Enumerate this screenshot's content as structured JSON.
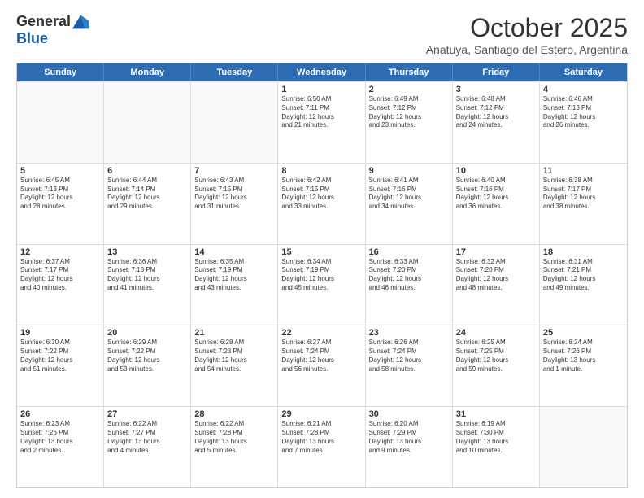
{
  "logo": {
    "general": "General",
    "blue": "Blue"
  },
  "title": "October 2025",
  "subtitle": "Anatuya, Santiago del Estero, Argentina",
  "days_of_week": [
    "Sunday",
    "Monday",
    "Tuesday",
    "Wednesday",
    "Thursday",
    "Friday",
    "Saturday"
  ],
  "weeks": [
    [
      {
        "day": "",
        "info": ""
      },
      {
        "day": "",
        "info": ""
      },
      {
        "day": "",
        "info": ""
      },
      {
        "day": "1",
        "info": "Sunrise: 6:50 AM\nSunset: 7:11 PM\nDaylight: 12 hours\nand 21 minutes."
      },
      {
        "day": "2",
        "info": "Sunrise: 6:49 AM\nSunset: 7:12 PM\nDaylight: 12 hours\nand 23 minutes."
      },
      {
        "day": "3",
        "info": "Sunrise: 6:48 AM\nSunset: 7:12 PM\nDaylight: 12 hours\nand 24 minutes."
      },
      {
        "day": "4",
        "info": "Sunrise: 6:46 AM\nSunset: 7:13 PM\nDaylight: 12 hours\nand 26 minutes."
      }
    ],
    [
      {
        "day": "5",
        "info": "Sunrise: 6:45 AM\nSunset: 7:13 PM\nDaylight: 12 hours\nand 28 minutes."
      },
      {
        "day": "6",
        "info": "Sunrise: 6:44 AM\nSunset: 7:14 PM\nDaylight: 12 hours\nand 29 minutes."
      },
      {
        "day": "7",
        "info": "Sunrise: 6:43 AM\nSunset: 7:15 PM\nDaylight: 12 hours\nand 31 minutes."
      },
      {
        "day": "8",
        "info": "Sunrise: 6:42 AM\nSunset: 7:15 PM\nDaylight: 12 hours\nand 33 minutes."
      },
      {
        "day": "9",
        "info": "Sunrise: 6:41 AM\nSunset: 7:16 PM\nDaylight: 12 hours\nand 34 minutes."
      },
      {
        "day": "10",
        "info": "Sunrise: 6:40 AM\nSunset: 7:16 PM\nDaylight: 12 hours\nand 36 minutes."
      },
      {
        "day": "11",
        "info": "Sunrise: 6:38 AM\nSunset: 7:17 PM\nDaylight: 12 hours\nand 38 minutes."
      }
    ],
    [
      {
        "day": "12",
        "info": "Sunrise: 6:37 AM\nSunset: 7:17 PM\nDaylight: 12 hours\nand 40 minutes."
      },
      {
        "day": "13",
        "info": "Sunrise: 6:36 AM\nSunset: 7:18 PM\nDaylight: 12 hours\nand 41 minutes."
      },
      {
        "day": "14",
        "info": "Sunrise: 6:35 AM\nSunset: 7:19 PM\nDaylight: 12 hours\nand 43 minutes."
      },
      {
        "day": "15",
        "info": "Sunrise: 6:34 AM\nSunset: 7:19 PM\nDaylight: 12 hours\nand 45 minutes."
      },
      {
        "day": "16",
        "info": "Sunrise: 6:33 AM\nSunset: 7:20 PM\nDaylight: 12 hours\nand 46 minutes."
      },
      {
        "day": "17",
        "info": "Sunrise: 6:32 AM\nSunset: 7:20 PM\nDaylight: 12 hours\nand 48 minutes."
      },
      {
        "day": "18",
        "info": "Sunrise: 6:31 AM\nSunset: 7:21 PM\nDaylight: 12 hours\nand 49 minutes."
      }
    ],
    [
      {
        "day": "19",
        "info": "Sunrise: 6:30 AM\nSunset: 7:22 PM\nDaylight: 12 hours\nand 51 minutes."
      },
      {
        "day": "20",
        "info": "Sunrise: 6:29 AM\nSunset: 7:22 PM\nDaylight: 12 hours\nand 53 minutes."
      },
      {
        "day": "21",
        "info": "Sunrise: 6:28 AM\nSunset: 7:23 PM\nDaylight: 12 hours\nand 54 minutes."
      },
      {
        "day": "22",
        "info": "Sunrise: 6:27 AM\nSunset: 7:24 PM\nDaylight: 12 hours\nand 56 minutes."
      },
      {
        "day": "23",
        "info": "Sunrise: 6:26 AM\nSunset: 7:24 PM\nDaylight: 12 hours\nand 58 minutes."
      },
      {
        "day": "24",
        "info": "Sunrise: 6:25 AM\nSunset: 7:25 PM\nDaylight: 12 hours\nand 59 minutes."
      },
      {
        "day": "25",
        "info": "Sunrise: 6:24 AM\nSunset: 7:26 PM\nDaylight: 13 hours\nand 1 minute."
      }
    ],
    [
      {
        "day": "26",
        "info": "Sunrise: 6:23 AM\nSunset: 7:26 PM\nDaylight: 13 hours\nand 2 minutes."
      },
      {
        "day": "27",
        "info": "Sunrise: 6:22 AM\nSunset: 7:27 PM\nDaylight: 13 hours\nand 4 minutes."
      },
      {
        "day": "28",
        "info": "Sunrise: 6:22 AM\nSunset: 7:28 PM\nDaylight: 13 hours\nand 5 minutes."
      },
      {
        "day": "29",
        "info": "Sunrise: 6:21 AM\nSunset: 7:28 PM\nDaylight: 13 hours\nand 7 minutes."
      },
      {
        "day": "30",
        "info": "Sunrise: 6:20 AM\nSunset: 7:29 PM\nDaylight: 13 hours\nand 9 minutes."
      },
      {
        "day": "31",
        "info": "Sunrise: 6:19 AM\nSunset: 7:30 PM\nDaylight: 13 hours\nand 10 minutes."
      },
      {
        "day": "",
        "info": ""
      }
    ]
  ]
}
